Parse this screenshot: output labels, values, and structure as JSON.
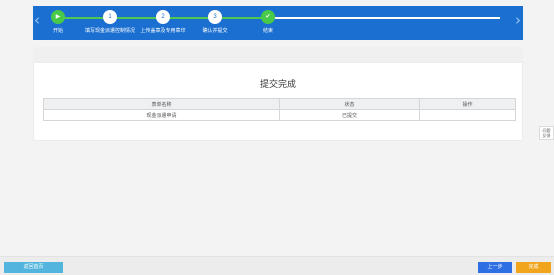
{
  "nav": {
    "prev_symbol": "‹",
    "next_symbol": "›"
  },
  "steps": [
    {
      "marker": "▶",
      "label": "开始",
      "state": "done"
    },
    {
      "marker": "1",
      "label": "填写现金派遣控制情况",
      "state": "todo"
    },
    {
      "marker": "2",
      "label": "上传盖章及专用章印",
      "state": "todo"
    },
    {
      "marker": "3",
      "label": "确认并提交",
      "state": "todo"
    },
    {
      "marker": "✔",
      "label": "结束",
      "state": "done"
    }
  ],
  "result": {
    "title": "提交完成",
    "columns": [
      "表单名称",
      "状态",
      "操作"
    ],
    "rows": [
      {
        "name": "现金派遣申请",
        "status": "已提交",
        "action": ""
      }
    ]
  },
  "side_tab": {
    "line1": "问题",
    "line2": "反馈"
  },
  "footer": {
    "home_label": "返回首页",
    "prev_label": "上一步",
    "finish_label": "完成"
  },
  "colors": {
    "header_bg": "#1a6fd0",
    "step_done": "#49c94a",
    "btn_home": "#53b5de",
    "btn_prev": "#2f6fe4",
    "btn_finish": "#f0a51c"
  }
}
